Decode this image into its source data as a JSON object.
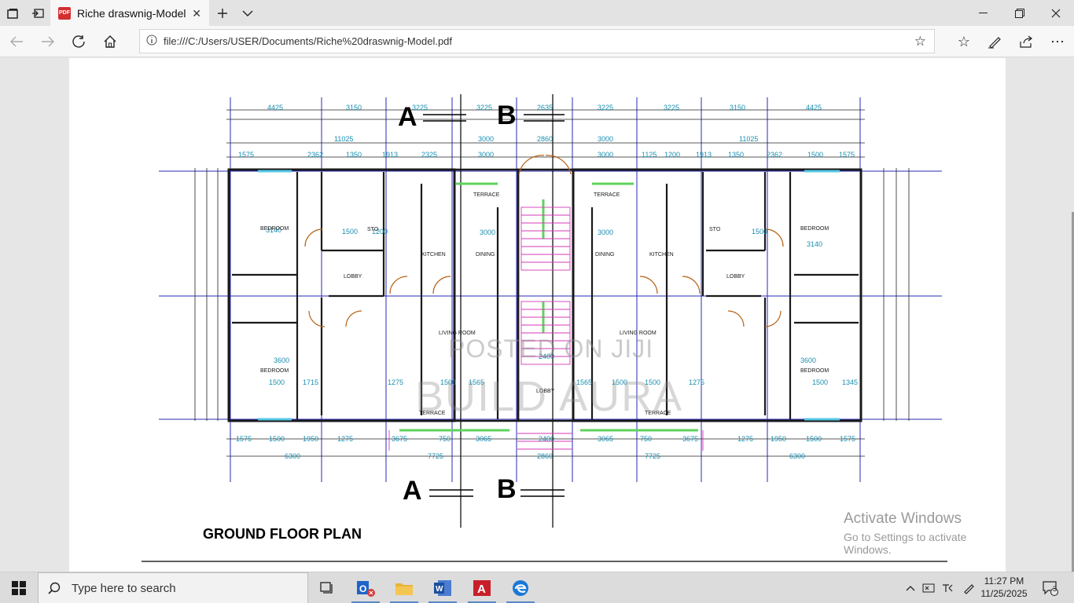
{
  "browser": {
    "tab_title": "Riche draswnig-Model.p",
    "tab_icon": "pdf-icon",
    "url": "file:///C:/Users/USER/Documents/Riche%20draswnig-Model.pdf"
  },
  "drawing": {
    "title": "GROUND FLOOR PLAN",
    "section_marks": {
      "a": "A",
      "b": "B"
    },
    "watermark_line1": "POSTED ON JIJI",
    "watermark_line2": "BUILD AURA",
    "top_dimensions": [
      "4425",
      "3150",
      "3225",
      "3225",
      "2635",
      "3225",
      "3225",
      "3150",
      "4425"
    ],
    "overall_dimensions": [
      "11025",
      "3000",
      "2860",
      "3000",
      "11025"
    ],
    "room_labels": [
      "BEDROOM",
      "BEDROOM",
      "STO",
      "LOBBY",
      "KITCHEN",
      "DINING",
      "LIVING ROOM",
      "TERRACE",
      "LOBBY",
      "DINING",
      "KITCHEN",
      "LIVING ROOM",
      "TERRACE",
      "STO",
      "LOBBY",
      "BEDROOM",
      "BEDROOM"
    ],
    "bottom_dimensions": [
      "1575",
      "1500",
      "1950",
      "1275",
      "3675",
      "750",
      "3065",
      "2400",
      "3065",
      "750",
      "3675",
      "1275",
      "1950",
      "1500",
      "1575"
    ],
    "bottom_totals": [
      "6300",
      "7725",
      "2860",
      "7725",
      "6300"
    ]
  },
  "os_notice": {
    "line1": "Activate Windows",
    "line2": "Go to Settings to activate Windows."
  },
  "taskbar": {
    "search_placeholder": "Type here to search",
    "time": "11:27 PM",
    "date": "11/25/2025",
    "notification_count": "3",
    "apps": [
      "task-view",
      "outlook",
      "file-explorer",
      "word",
      "autocad",
      "edge"
    ]
  },
  "colors": {
    "dimension": "#1a8fb0",
    "grid": "#1c1cb8",
    "wall": "#1a1a1a",
    "stair": "#d63ab4",
    "door": "#b8651a",
    "window": "#5fd35f"
  }
}
